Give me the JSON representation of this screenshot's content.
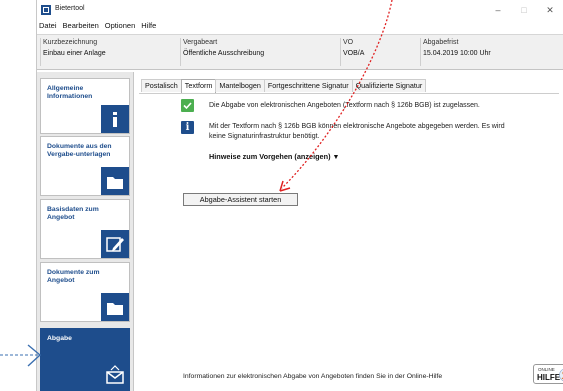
{
  "window": {
    "title": "Bietertool",
    "controls": {
      "minimize": "–",
      "maximize": "□",
      "close": "✕"
    }
  },
  "menu": [
    "Datei",
    "Bearbeiten",
    "Optionen",
    "Hilfe"
  ],
  "info": {
    "kurz": {
      "label": "Kurzbezeichnung",
      "value": "Einbau einer Anlage"
    },
    "vergabeart": {
      "label": "Vergabeart",
      "value": "Öffentliche Ausschreibung"
    },
    "vo": {
      "label": "VO",
      "value": "VOB/A"
    },
    "frist": {
      "label": "Abgabefrist",
      "value": "15.04.2019 10:00 Uhr"
    }
  },
  "sidebar": {
    "items": [
      {
        "label": "Allgemeine Informationen",
        "icon": "info-icon"
      },
      {
        "label": "Dokumente aus den Vergabe-unterlagen",
        "icon": "folder-icon"
      },
      {
        "label": "Basisdaten zum Angebot",
        "icon": "pen-icon"
      },
      {
        "label": "Dokumente zum Angebot",
        "icon": "folder-icon"
      },
      {
        "label": "Abgabe",
        "icon": "envelope-icon"
      }
    ]
  },
  "tabs": [
    "Postalisch",
    "Textform",
    "Mantelbogen",
    "Fortgeschrittene Signatur",
    "Qualifizierte Signatur"
  ],
  "active_tab": "Textform",
  "content": {
    "check_text": "Die Abgabe von elektronischen Angeboten (Textform nach § 126b BGB) ist zugelassen.",
    "info_line1": "Mit der Textform nach § 126b BGB können elektronische Angebote abgegeben werden. Es wird",
    "info_line2": "keine Signaturinfrastruktur benötigt.",
    "hint": "Hinweise zum Vorgehen (anzeigen)",
    "hint_caret": "▼",
    "button": "Abgabe-Assistent starten",
    "footer": "Informationen zur elektronischen Abgabe von Angeboten finden Sie in der Online-Hilfe",
    "help_small": "ONLINE",
    "help_big": "HILFE"
  },
  "colors": {
    "accent": "#1e4d8c",
    "check": "#4caf50",
    "arrow": "#e02020",
    "pointer": "#3a6fb0"
  }
}
